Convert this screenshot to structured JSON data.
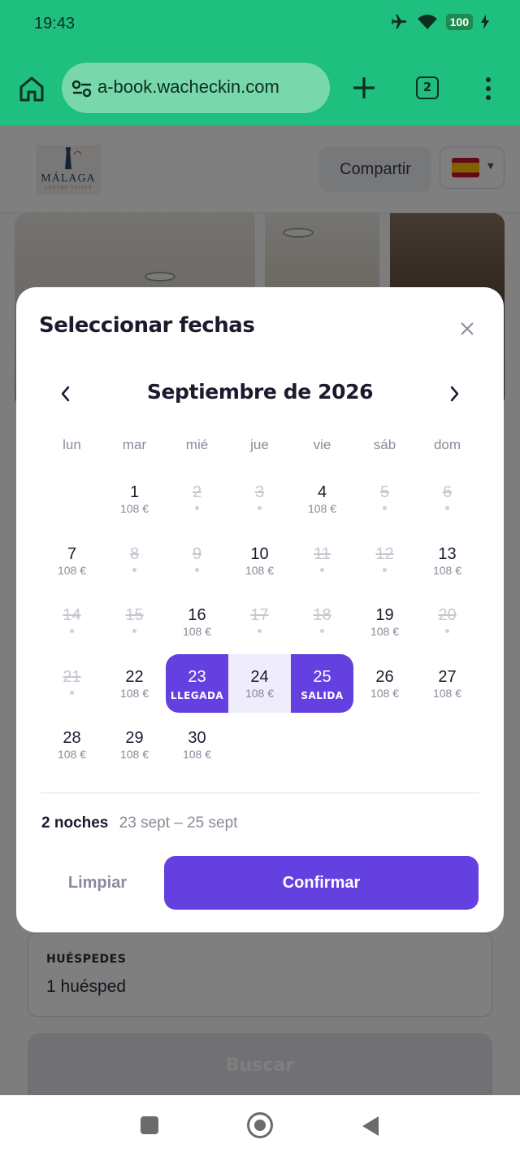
{
  "status_bar": {
    "time": "19:43",
    "battery": "100"
  },
  "browser": {
    "url": "a-book.wacheckin.com",
    "tab_count": "2"
  },
  "header": {
    "logo_text": "MÁLAGA",
    "logo_sub": "CENTRO SUITES",
    "share_label": "Compartir",
    "language_flag": "spain-flag-icon"
  },
  "guests": {
    "label": "HUÉSPEDES",
    "value": "1 huésped"
  },
  "search": {
    "label": "Buscar"
  },
  "modal": {
    "title": "Seleccionar fechas",
    "month_label": "Septiembre de 2026",
    "weekdays": [
      "lun",
      "mar",
      "mié",
      "jue",
      "vie",
      "sáb",
      "dom"
    ],
    "days": [
      {
        "num": "1",
        "price": "108 €",
        "state": "available"
      },
      {
        "num": "2",
        "price": "",
        "state": "disabled"
      },
      {
        "num": "3",
        "price": "",
        "state": "disabled"
      },
      {
        "num": "4",
        "price": "108 €",
        "state": "available"
      },
      {
        "num": "5",
        "price": "",
        "state": "disabled"
      },
      {
        "num": "6",
        "price": "",
        "state": "disabled"
      },
      {
        "num": "7",
        "price": "108 €",
        "state": "available"
      },
      {
        "num": "8",
        "price": "",
        "state": "disabled"
      },
      {
        "num": "9",
        "price": "",
        "state": "disabled"
      },
      {
        "num": "10",
        "price": "108 €",
        "state": "available"
      },
      {
        "num": "11",
        "price": "",
        "state": "disabled"
      },
      {
        "num": "12",
        "price": "",
        "state": "disabled"
      },
      {
        "num": "13",
        "price": "108 €",
        "state": "available"
      },
      {
        "num": "14",
        "price": "",
        "state": "disabled"
      },
      {
        "num": "15",
        "price": "",
        "state": "disabled"
      },
      {
        "num": "16",
        "price": "108 €",
        "state": "available"
      },
      {
        "num": "17",
        "price": "",
        "state": "disabled"
      },
      {
        "num": "18",
        "price": "",
        "state": "disabled"
      },
      {
        "num": "19",
        "price": "108 €",
        "state": "available"
      },
      {
        "num": "20",
        "price": "",
        "state": "disabled"
      },
      {
        "num": "21",
        "price": "",
        "state": "disabled"
      },
      {
        "num": "22",
        "price": "108 €",
        "state": "available"
      },
      {
        "num": "23",
        "price": "",
        "state": "start",
        "tag": "LLEGADA"
      },
      {
        "num": "24",
        "price": "108 €",
        "state": "in-range"
      },
      {
        "num": "25",
        "price": "",
        "state": "end",
        "tag": "SALIDA"
      },
      {
        "num": "26",
        "price": "108 €",
        "state": "available"
      },
      {
        "num": "27",
        "price": "108 €",
        "state": "available"
      },
      {
        "num": "28",
        "price": "108 €",
        "state": "available"
      },
      {
        "num": "29",
        "price": "108 €",
        "state": "available"
      },
      {
        "num": "30",
        "price": "108 €",
        "state": "available"
      }
    ],
    "summary_nights": "2 noches",
    "summary_range": "23 sept – 25 sept",
    "clear_label": "Limpiar",
    "confirm_label": "Confirmar"
  },
  "colors": {
    "chrome": "#1fbf7f",
    "accent": "#6440e0",
    "range": "#efecfc"
  }
}
